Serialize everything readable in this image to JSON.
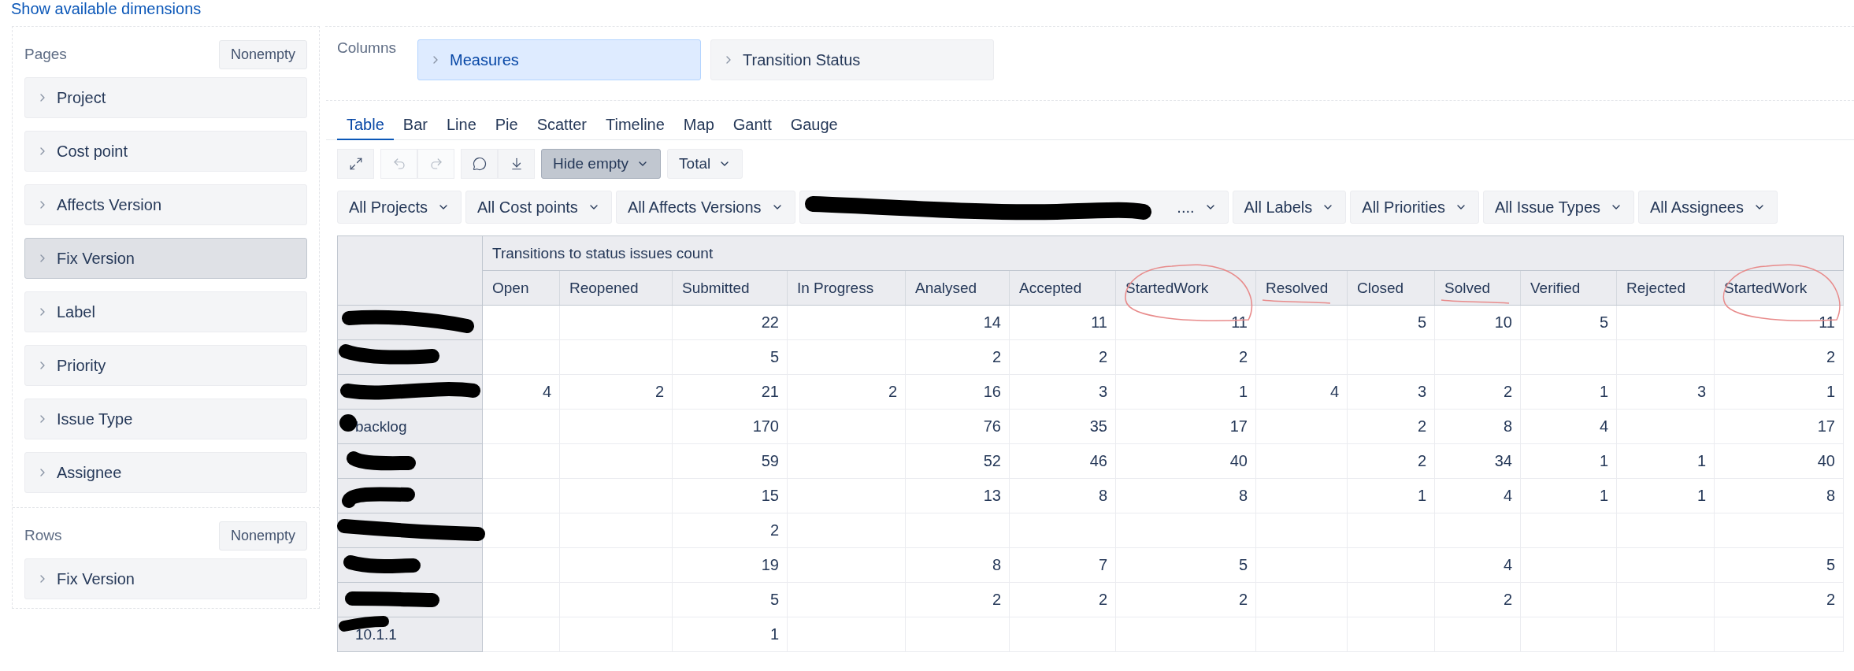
{
  "top_link": "Show available dimensions",
  "pages": {
    "title": "Pages",
    "nonempty": "Nonempty",
    "items": [
      {
        "label": "Project",
        "selected": false
      },
      {
        "label": "Cost point",
        "selected": false
      },
      {
        "label": "Affects Version",
        "selected": false
      },
      {
        "label": "Fix Version",
        "selected": true
      },
      {
        "label": "Label",
        "selected": false
      },
      {
        "label": "Priority",
        "selected": false
      },
      {
        "label": "Issue Type",
        "selected": false
      },
      {
        "label": "Assignee",
        "selected": false
      }
    ]
  },
  "rows_section": {
    "title": "Rows",
    "nonempty": "Nonempty",
    "items": [
      {
        "label": "Fix Version",
        "selected": false
      }
    ]
  },
  "columns_section": {
    "title": "Columns",
    "items": [
      {
        "label": "Measures",
        "selected": true
      },
      {
        "label": "Transition Status",
        "selected": false
      }
    ]
  },
  "tabs": [
    {
      "label": "Table",
      "selected": true
    },
    {
      "label": "Bar",
      "selected": false
    },
    {
      "label": "Line",
      "selected": false
    },
    {
      "label": "Pie",
      "selected": false
    },
    {
      "label": "Scatter",
      "selected": false
    },
    {
      "label": "Timeline",
      "selected": false
    },
    {
      "label": "Map",
      "selected": false
    },
    {
      "label": "Gantt",
      "selected": false
    },
    {
      "label": "Gauge",
      "selected": false
    }
  ],
  "toolbar": {
    "icons": [
      {
        "kind": "fullscreen",
        "disabled": false
      },
      {
        "kind": "undo",
        "disabled": true
      },
      {
        "kind": "redo",
        "disabled": true
      },
      {
        "kind": "comment",
        "disabled": false
      },
      {
        "kind": "download",
        "disabled": false
      }
    ],
    "dropdowns": [
      {
        "label": "Hide empty",
        "selected": true
      },
      {
        "label": "Total",
        "selected": false
      }
    ]
  },
  "filters": [
    {
      "label": "All Projects",
      "redacted": false
    },
    {
      "label": "All Cost points",
      "redacted": false
    },
    {
      "label": "All Affects Versions",
      "redacted": false
    },
    {
      "label": "....",
      "redacted": true
    },
    {
      "label": "All Labels",
      "redacted": false
    },
    {
      "label": "All Priorities",
      "redacted": false
    },
    {
      "label": "All Issue Types",
      "redacted": false
    },
    {
      "label": "All Assignees",
      "redacted": false
    }
  ],
  "table": {
    "group_header": "Transitions to status issues count",
    "columns": [
      {
        "label": "Open"
      },
      {
        "label": "Reopened"
      },
      {
        "label": "Submitted"
      },
      {
        "label": "In Progress"
      },
      {
        "label": "Analysed"
      },
      {
        "label": "Accepted"
      },
      {
        "label": "StartedWork",
        "circled": true
      },
      {
        "label": "Resolved",
        "underlined": true
      },
      {
        "label": "Closed"
      },
      {
        "label": "Solved",
        "underlined": true
      },
      {
        "label": "Verified"
      },
      {
        "label": "Rejected"
      },
      {
        "label": "StartedWork",
        "circled": true
      }
    ],
    "rows": [
      {
        "redacted": true,
        "cells": [
          null,
          null,
          "22",
          null,
          "14",
          "11",
          "11",
          null,
          "5",
          "10",
          "5",
          null,
          "11"
        ]
      },
      {
        "redacted": true,
        "cells": [
          null,
          null,
          "5",
          null,
          "2",
          "2",
          "2",
          null,
          null,
          null,
          null,
          null,
          "2"
        ]
      },
      {
        "redacted": true,
        "cells": [
          "4",
          "2",
          "21",
          "2",
          "16",
          "3",
          "1",
          "4",
          "3",
          "2",
          "1",
          "3",
          "1"
        ]
      },
      {
        "label": "backlog",
        "redacted": true,
        "cells": [
          null,
          null,
          "170",
          null,
          "76",
          "35",
          "17",
          null,
          "2",
          "8",
          "4",
          null,
          "17"
        ]
      },
      {
        "redacted": true,
        "cells": [
          null,
          null,
          "59",
          null,
          "52",
          "46",
          "40",
          null,
          "2",
          "34",
          "1",
          "1",
          "40"
        ]
      },
      {
        "redacted": true,
        "cells": [
          null,
          null,
          "15",
          null,
          "13",
          "8",
          "8",
          null,
          "1",
          "4",
          "1",
          "1",
          "8"
        ]
      },
      {
        "redacted": true,
        "cells": [
          null,
          null,
          "2",
          null,
          null,
          null,
          null,
          null,
          null,
          null,
          null,
          null,
          null
        ]
      },
      {
        "redacted": true,
        "cells": [
          null,
          null,
          "19",
          null,
          "8",
          "7",
          "5",
          null,
          null,
          "4",
          null,
          null,
          "5"
        ]
      },
      {
        "redacted": true,
        "cells": [
          null,
          null,
          "5",
          null,
          "2",
          "2",
          "2",
          null,
          null,
          "2",
          null,
          null,
          "2"
        ]
      },
      {
        "label": "10.1.1",
        "redacted": true,
        "cells": [
          null,
          null,
          "1",
          null,
          null,
          null,
          null,
          null,
          null,
          null,
          null,
          null,
          null
        ]
      }
    ]
  }
}
